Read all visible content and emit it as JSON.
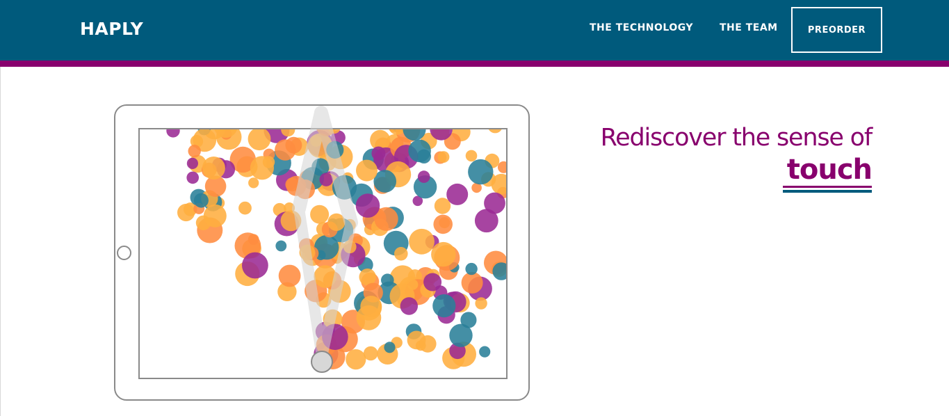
{
  "navbar": {
    "brand": "HAPLY",
    "links": [
      "THE TECHNOLOGY",
      "THE TEAM"
    ],
    "cta": "PREORDER"
  },
  "hero": {
    "headline": "Rediscover the sense of",
    "emphasis": "touch"
  },
  "colors": {
    "navbar": "#005a7c",
    "stripe": "#88006d",
    "bubble_orange": "#ff8c40",
    "bubble_gold": "#ffae40",
    "bubble_purple": "#9b2a94",
    "bubble_teal": "#2a7f98",
    "arm": "#d9d9d9",
    "frame": "#8a8a8a"
  },
  "illustration": {
    "device": "tablet",
    "icons": [
      "home-button-icon",
      "haptic-arm-icon"
    ]
  }
}
